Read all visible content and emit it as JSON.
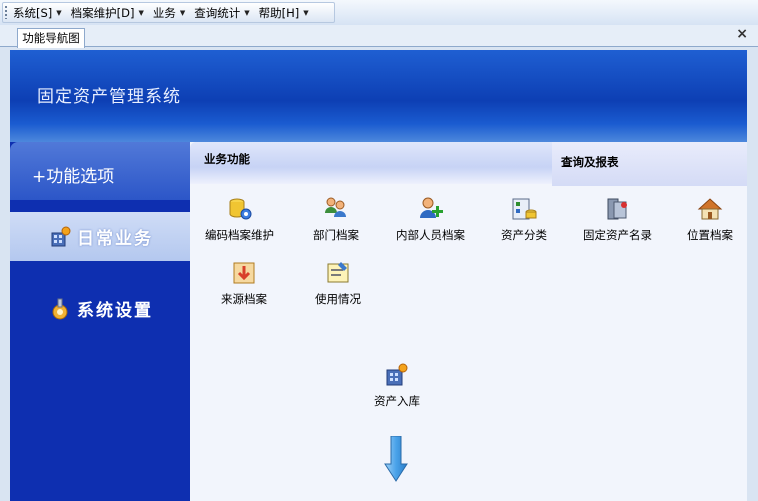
{
  "menubar": {
    "items": [
      {
        "label": "系统[S]"
      },
      {
        "label": "档案维护[D]"
      },
      {
        "label": "业务"
      },
      {
        "label": "查询统计"
      },
      {
        "label": "帮助[H]"
      }
    ]
  },
  "tabs": {
    "active": "功能导航图",
    "close_glyph": "×"
  },
  "banner": {
    "title": "固定资产管理系统"
  },
  "sidebar": {
    "header": "+功能选项",
    "items": [
      {
        "label": "日常业务",
        "icon": "daily-business-icon"
      },
      {
        "label": "系统设置",
        "icon": "system-settings-icon"
      }
    ]
  },
  "business": {
    "title": "业务功能",
    "functions": [
      {
        "label": "编码档案维护",
        "icon": "database-gear-icon"
      },
      {
        "label": "部门档案",
        "icon": "department-users-icon"
      },
      {
        "label": "内部人员档案",
        "icon": "add-person-icon"
      },
      {
        "label": "资产分类",
        "icon": "asset-category-icon"
      },
      {
        "label": "固定资产名录",
        "icon": "asset-list-icon"
      },
      {
        "label": "位置档案",
        "icon": "home-icon"
      },
      {
        "label": "来源档案",
        "icon": "source-icon"
      },
      {
        "label": "使用情况",
        "icon": "usage-note-icon"
      },
      {
        "label": "资产入库",
        "icon": "asset-inbound-icon"
      }
    ]
  },
  "query": {
    "title": "查询及报表"
  },
  "colors": {
    "banner": "#0d3fb4",
    "sidebar": "#0e2fb0",
    "content_bg": "#f2f5fc"
  }
}
